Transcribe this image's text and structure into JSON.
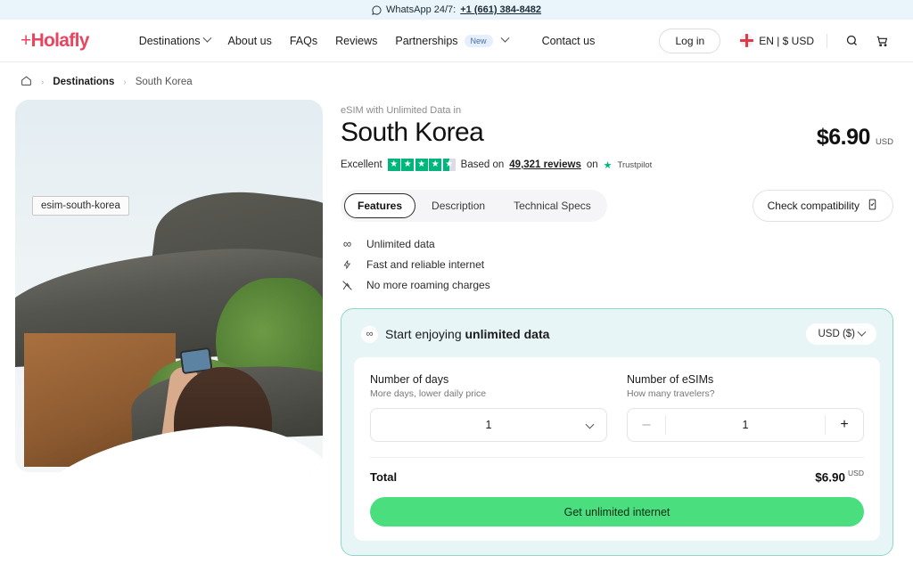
{
  "topbar": {
    "icon": "whatsapp-icon",
    "text": "WhatsApp 24/7:",
    "phone": "+1 (661) 384-8482"
  },
  "header": {
    "logo": "Holafly",
    "nav": [
      {
        "label": "Destinations",
        "has_chevron": true
      },
      {
        "label": "About us",
        "has_chevron": false
      },
      {
        "label": "FAQs",
        "has_chevron": false
      },
      {
        "label": "Reviews",
        "has_chevron": false
      },
      {
        "label": "Partnerships",
        "badge": "New",
        "has_chevron": true
      },
      {
        "label": "Contact us",
        "has_chevron": false
      }
    ],
    "login_label": "Log in",
    "locale": "EN | $ USD",
    "flag": "uk-flag-icon",
    "search_icon": "search-icon",
    "cart_icon": "cart-icon"
  },
  "breadcrumb": {
    "home_icon": "home-icon",
    "sep": "›",
    "items": [
      {
        "label": "Destinations"
      },
      {
        "label": "South Korea"
      }
    ]
  },
  "hero": {
    "alt_tooltip": "esim-south-korea"
  },
  "product": {
    "eyebrow": "eSIM with Unlimited Data in",
    "title": "South Korea",
    "price": "$6.90",
    "price_currency": "USD",
    "rating": {
      "word": "Excellent",
      "stars": 4.5,
      "based_on": "Based on",
      "reviews": "49,321 reviews",
      "on": "on",
      "platform": "Trustpilot",
      "star_color": "#00b67a"
    },
    "tabs": [
      {
        "label": "Features",
        "active": true
      },
      {
        "label": "Description",
        "active": false
      },
      {
        "label": "Technical Specs",
        "active": false
      }
    ],
    "compatibility_label": "Check compatibility",
    "compatibility_icon": "phone-check-icon",
    "features": [
      {
        "icon": "infinity-icon",
        "glyph": "∞",
        "label": "Unlimited data"
      },
      {
        "icon": "bolt-icon",
        "glyph": "⚡",
        "label": "Fast and reliable internet"
      },
      {
        "icon": "no-roaming-icon",
        "glyph": "📵",
        "label": "No more roaming charges"
      }
    ]
  },
  "buy_card": {
    "icon": "infinity-icon",
    "heading_prefix": "Start enjoying ",
    "heading_strong": "unlimited data",
    "currency_selector": "USD ($)",
    "days": {
      "label": "Number of days",
      "sub": "More days, lower daily price",
      "value": "1"
    },
    "esims": {
      "label": "Number of eSIMs",
      "sub": "How many travelers?",
      "value": "1",
      "minus": "–",
      "plus": "+"
    },
    "total_label": "Total",
    "total_value": "$6.90",
    "total_currency": "USD",
    "cta_label": "Get unlimited internet",
    "cta_color": "#4ade7e",
    "card_bg": "#e7f5f6",
    "card_border": "#8fd6c9"
  }
}
